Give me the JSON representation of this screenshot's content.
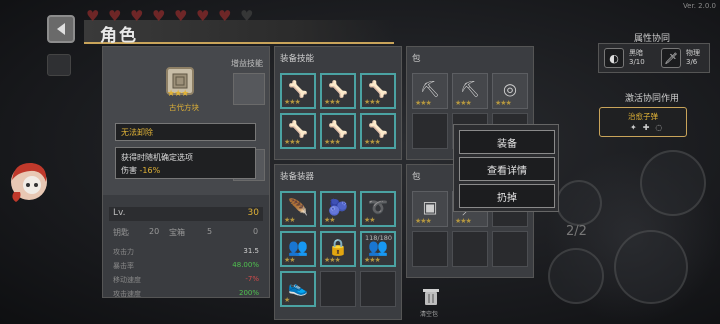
{
  "version": "Ver. 2.0.0",
  "header": {
    "title": "角色",
    "hearts_full": 7,
    "hearts_total": 8
  },
  "character": {
    "gain_skills_title": "增益技能",
    "selected_item": {
      "name": "古代方块",
      "stars": "★★★"
    },
    "tooltip_cannot_unequip": "无法卸除",
    "tooltip_random_option": "获得时随机确定选项",
    "tooltip_damage_label": "伤害",
    "tooltip_damage_value": "-16%",
    "level_label": "Lv.",
    "level_value": "30",
    "stats": [
      {
        "label": "攻击力",
        "value": "31.5",
        "color": "white"
      },
      {
        "label": "暴击率",
        "value": "48.00%",
        "color": "green"
      },
      {
        "label": "移动速度",
        "value": "-7%",
        "color": "red"
      },
      {
        "label": "攻击速度",
        "value": "200%",
        "color": "green"
      }
    ],
    "row2": {
      "a_label": "钥匙",
      "a_value": "20",
      "b_label": "宝箱",
      "b_value": "5",
      "c_value": "0"
    }
  },
  "panels": {
    "equip_skills_title": "装备技能",
    "bag_top_title": "包",
    "equip_items_title": "装备装器",
    "bag_bottom_title": "包",
    "equip_skill_slots": [
      {
        "icon": "🦴",
        "stars": "★★★"
      },
      {
        "icon": "🦴",
        "stars": "★★★"
      },
      {
        "icon": "🦴",
        "stars": "★★★"
      },
      {
        "icon": "🦴",
        "stars": "★★★"
      },
      {
        "icon": "🦴",
        "stars": "★★★"
      },
      {
        "icon": "🦴",
        "stars": "★★★"
      }
    ],
    "bag_top_slots": [
      {
        "icon": "⛏",
        "stars": "★★★"
      },
      {
        "icon": "⛏",
        "stars": "★★★"
      },
      {
        "icon": "◎",
        "stars": "★★★"
      }
    ],
    "equip_item_slots": [
      {
        "icon": "🪶",
        "stars": "★★"
      },
      {
        "icon": "🫐",
        "stars": "★★"
      },
      {
        "icon": "➰",
        "stars": "★★"
      },
      {
        "icon": "👥",
        "stars": "★★"
      },
      {
        "icon": "🔒",
        "stars": "★★★"
      },
      {
        "icon": "👥",
        "stars": "★★★",
        "count": "118/180"
      },
      {
        "icon": "👟",
        "stars": "★"
      }
    ],
    "bag_bottom_slots": [
      {
        "icon": "▣",
        "stars": "★★★"
      },
      {
        "icon": "／",
        "stars": "★★★"
      }
    ]
  },
  "context_menu": {
    "equip": "装备",
    "details": "查看详情",
    "discard": "扔掉"
  },
  "trash_label": "清空包",
  "synergy": {
    "title": "属性协同",
    "items": [
      {
        "name": "黑暗",
        "value": "3/10",
        "icon": "◐"
      },
      {
        "name": "物理",
        "value": "3/6",
        "icon": "🗡"
      }
    ],
    "active_title": "激活协同作用",
    "active_name": "治愈子弹"
  },
  "page_indicator": "2/2"
}
